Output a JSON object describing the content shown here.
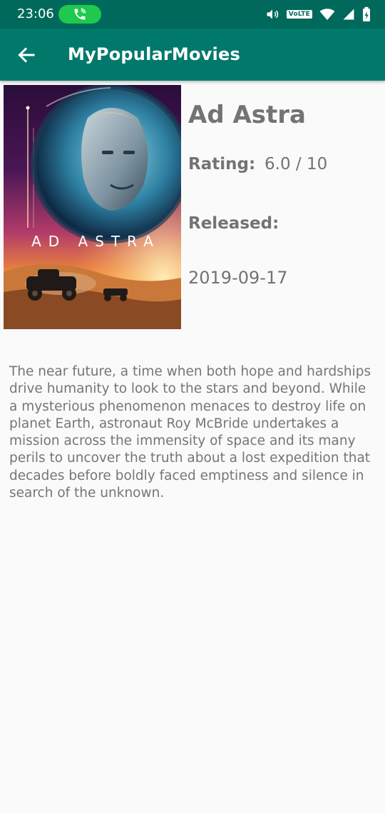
{
  "status_bar": {
    "time": "23:06",
    "volte": "VoLTE",
    "icons": [
      "call-active-icon",
      "volume-icon",
      "volte-icon",
      "wifi-icon",
      "signal-icon",
      "battery-charging-icon"
    ]
  },
  "app_bar": {
    "title": "MyPopularMovies",
    "back_icon": "arrow-back-icon",
    "color": "#00796b"
  },
  "movie": {
    "poster_title": "AD ASTRA",
    "title": "Ad Astra",
    "rating_label": "Rating:",
    "rating_value": "6.0 / 10",
    "released_label": "Released:",
    "released_date": "2019-09-17",
    "overview": "The near future, a time when both hope and hardships drive humanity to look to the stars and beyond. While a mysterious phenomenon menaces to destroy life on planet Earth, astronaut Roy McBride undertakes a mission across the immensity of space and its many perils to uncover the truth about a lost expedition that decades before boldly faced emptiness and silence in search of the unknown."
  },
  "colors": {
    "status_bar": "#00695c",
    "app_bar": "#00796b",
    "call_pill": "#1ec94d",
    "text": "#737373",
    "background": "#fafafa"
  }
}
